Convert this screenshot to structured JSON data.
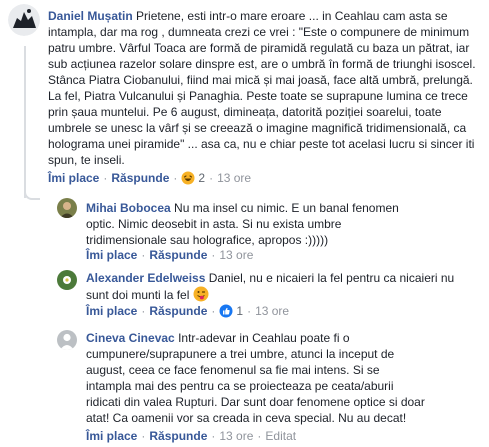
{
  "comments": [
    {
      "author": "Daniel Mușatin",
      "text": "Prietene, esti intr-o mare eroare ... in Ceahlau cam asta se intampla, dar ma rog , dumneata crezi ce vrei : \"Este o compunere de minimum patru umbre. Vârful Toaca are formă de piramidă regulată cu baza un pătrat, iar sub acțiunea razelor solare dinspre est, are o umbră în formă de triunghi isoscel. Stânca Piatra Ciobanului, fiind mai mică și mai joasă, face altă umbră, prelungă. La fel, Piatra Vulcanului și Panaghia. Peste toate se suprapune lumina ce trece prin șaua muntelui. Pe 6 august, dimineața, datorită poziției soarelui, toate umbrele se unesc la vârf și se creează o imagine magnifică tridimensională, ca holograma unei piramide\" ... asa ca, nu e chiar peste tot acelasi lucru si sincer iti spun, te inseli.",
      "like_label": "Îmi place",
      "reply_label": "Răspunde",
      "reaction_count": "2",
      "time": "13 ore"
    },
    {
      "author": "Mihai Bobocea",
      "text": "Nu ma insel cu nimic. E un banal fenomen optic. Nimic deosebit in asta. Si nu exista umbre tridimensionale sau holografice, apropos :)))))",
      "like_label": "Îmi place",
      "reply_label": "Răspunde",
      "time": "13 ore"
    },
    {
      "author": "Alexander Edelweiss",
      "text": "Daniel, nu e nicaieri la fel pentru ca nicaieri nu sunt doi munti la fel",
      "like_label": "Îmi place",
      "reply_label": "Răspunde",
      "reaction_count": "1",
      "time": "13 ore"
    },
    {
      "author": "Cineva Cinevac",
      "text": "Intr-adevar in Ceahlau poate fi o cumpunere/suprapunere a trei umbre, atunci la inceput de august, ceea ce face fenomenul sa fie mai intens. Si se intampla mai des pentru ca se proiecteaza pe ceata/aburii ridicati din valea Rupturi. Dar sunt doar fenomene optice si doar atat! Ca oamenii vor sa creada in ceva special. Nu au decat!",
      "like_label": "Îmi place",
      "reply_label": "Răspunde",
      "time": "13 ore",
      "edited_label": "Editat"
    }
  ],
  "colors": {
    "link": "#385898",
    "text": "#1d2129",
    "meta": "#90949c",
    "like": "#1877f2",
    "haha": "#f7b125"
  }
}
